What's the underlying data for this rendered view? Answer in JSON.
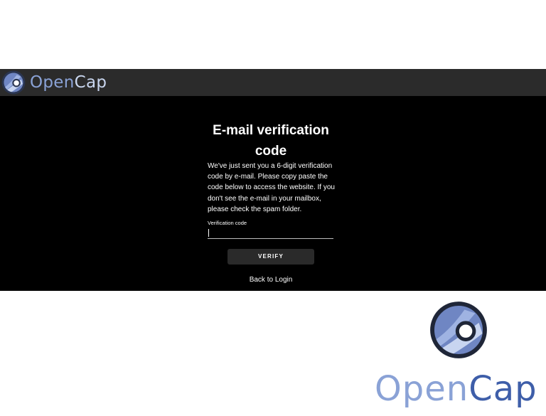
{
  "navbar": {
    "brand_part1": "Open",
    "brand_part2": "Cap",
    "logo_icon": "opencap-logo-icon"
  },
  "verification": {
    "title": "E-mail verification code",
    "description": "We've just sent you a 6-digit verification code by e-mail. Please copy paste the code below to access the website. If you don't see the e-mail in your mailbox, please check the spam folder.",
    "field_label": "Verification code",
    "field_value": "",
    "verify_button": "VERIFY",
    "back_link": "Back to Login"
  },
  "branding": {
    "brand_part1": "Open",
    "brand_part2": "Cap",
    "logo_icon": "opencap-logo-icon"
  },
  "colors": {
    "navbar_bg": "#2b2b2b",
    "page_bg": "#000000",
    "brand_light_blue": "#8aa2d6",
    "brand_dark_blue": "#3e5ea9",
    "button_bg": "#2a2a2a"
  }
}
